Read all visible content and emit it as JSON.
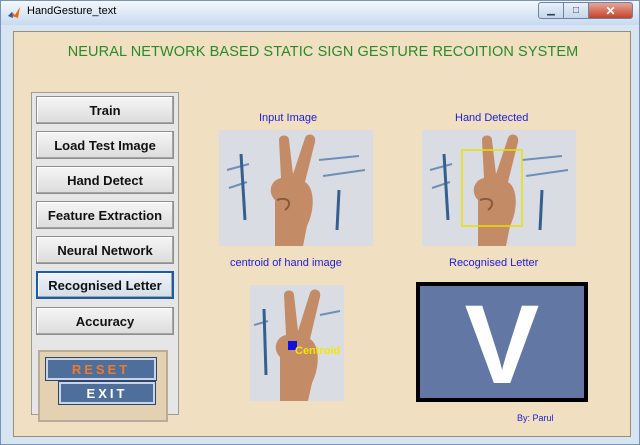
{
  "window": {
    "title": "HandGesture_text",
    "controls": {
      "minimize": "▁",
      "maximize": "□",
      "close": "✕"
    }
  },
  "heading": "NEURAL NETWORK BASED STATIC SIGN GESTURE RECOITION SYSTEM",
  "buttons": {
    "train": "Train",
    "load_test_image": "Load Test Image",
    "hand_detect": "Hand Detect",
    "feature_extraction": "Feature Extraction",
    "neural_network": "Neural Network",
    "recognised_letter": "Recognised Letter",
    "accuracy": "Accuracy",
    "reset": "RESET",
    "exit": "EXIT"
  },
  "labels": {
    "input_image": "Input  Image",
    "hand_detected": "Hand Detected",
    "centroid": "centroid of hand image",
    "recognised_letter": "Recognised Letter",
    "centroid_marker": "Centroid",
    "byline": "By: Parul"
  },
  "result": {
    "letter": "V"
  },
  "colors": {
    "figure_bg": "#f0dfc0",
    "heading": "#2a8a28",
    "label": "#2020d8",
    "reset_text": "#f07a2a",
    "exit_text": "#ffffff",
    "result_bg": "#6277a3",
    "detect_box": "#e8e000"
  },
  "icons": [
    "matlab-icon",
    "minimize-icon",
    "maximize-icon",
    "close-icon",
    "hand-v-sign-image",
    "centroid-marker-icon"
  ]
}
